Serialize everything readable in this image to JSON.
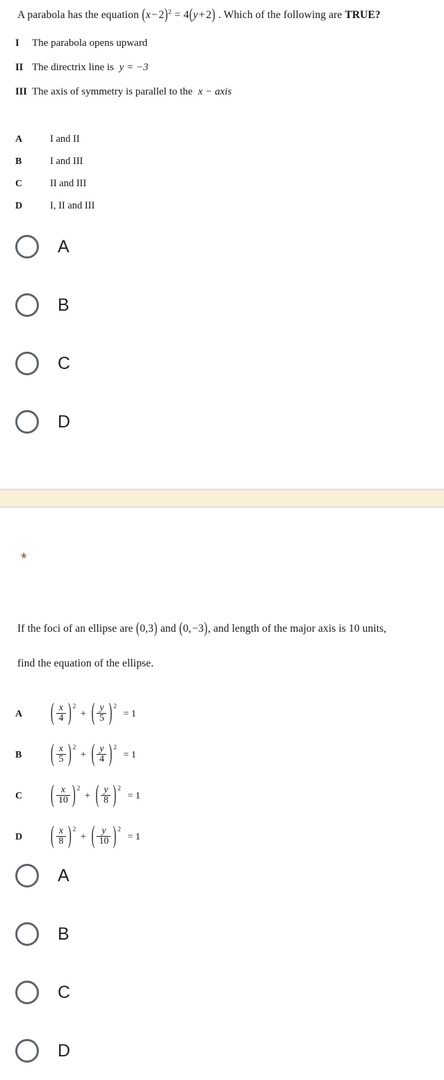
{
  "form": {
    "required_marker": "*",
    "section_band_color": "#faf0d7",
    "required_marker_color": "#b23a2d",
    "radio_outline_color": "#5f6368"
  },
  "question1": {
    "stem_part1": "A parabola has the equation",
    "stem_equation": "(x−2)² = 4(y+2)",
    "stem_part2": ". Which of the following are",
    "stem_bold_tail": "TRUE?",
    "statements": [
      {
        "numeral": "I",
        "text": "The parabola opens upward"
      },
      {
        "numeral": "II",
        "text": "The directrix line is",
        "math": "y = −3"
      },
      {
        "numeral": "III",
        "text": "The axis of symmetry is parallel to the",
        "math": "x − axis"
      }
    ],
    "options": [
      {
        "letter": "A",
        "text": "I and II"
      },
      {
        "letter": "B",
        "text": "I and III"
      },
      {
        "letter": "C",
        "text": "II and III"
      },
      {
        "letter": "D",
        "text": "I, II and III"
      }
    ],
    "choices": [
      {
        "label": "A"
      },
      {
        "label": "B"
      },
      {
        "label": "C"
      },
      {
        "label": "D"
      }
    ]
  },
  "question2": {
    "stem_line1_part1": "If the foci of an ellipse are",
    "stem_focus1": "(0,3)",
    "stem_line1_part2": "and",
    "stem_focus2": "(0,−3),",
    "stem_line1_part3": "and length of the major axis is 10 units,",
    "stem_line2": "find the equation of the ellipse.",
    "options": [
      {
        "letter": "A",
        "num1": "x",
        "den1": "4",
        "num2": "y",
        "den2": "5",
        "exp": "2",
        "equals": "= 1"
      },
      {
        "letter": "B",
        "num1": "x",
        "den1": "5",
        "num2": "y",
        "den2": "4",
        "exp": "2",
        "equals": "= 1"
      },
      {
        "letter": "C",
        "num1": "x",
        "den1": "10",
        "num2": "y",
        "den2": "8",
        "exp": "2",
        "equals": "= 1"
      },
      {
        "letter": "D",
        "num1": "x",
        "den1": "8",
        "num2": "y",
        "den2": "10",
        "exp": "2",
        "equals": "= 1"
      }
    ],
    "choices": [
      {
        "label": "A"
      },
      {
        "label": "B"
      },
      {
        "label": "C"
      },
      {
        "label": "D"
      }
    ]
  }
}
